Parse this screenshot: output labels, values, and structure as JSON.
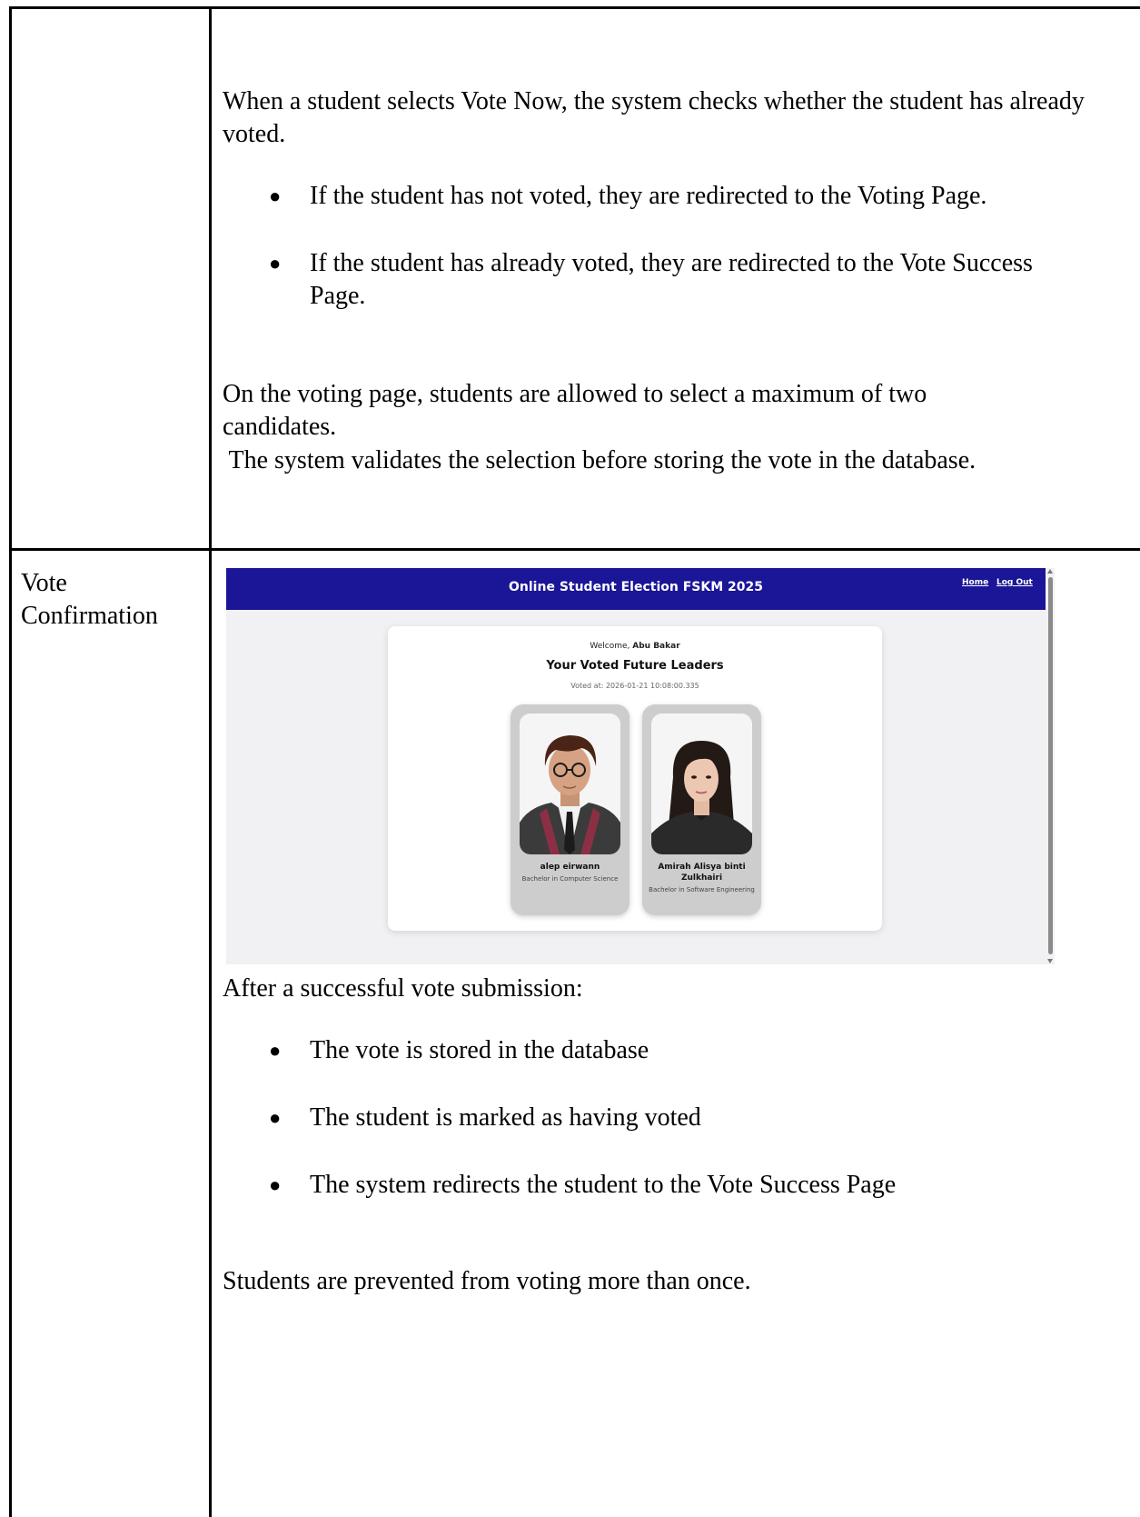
{
  "row1": {
    "intro": "When a student selects Vote Now, the system checks whether the student has already voted.",
    "bullets": [
      "If the student has not voted, they are redirected to the Voting Page.",
      "If the student has already voted, they are redirected to the Vote Success Page."
    ],
    "voting_page_line1": "On the voting page, students are allowed to select a maximum of two candidates.",
    "voting_page_line2": " The system validates the selection before storing the vote in the database."
  },
  "row2": {
    "label": "Vote Confirmation",
    "screenshot": {
      "header_title": "Online Student Election FSKM 2025",
      "nav": {
        "home": "Home",
        "logout": "Log Out"
      },
      "welcome_prefix": "Welcome,",
      "welcome_name": "Abu Bakar",
      "title": "Your Voted Future Leaders",
      "voted_at": "Voted at: 2026-01-21 10:08:00.335",
      "candidates": [
        {
          "name": "alep eirwann",
          "program": "Bachelor in Computer Science"
        },
        {
          "name": "Amirah Alisya binti Zulkhairi",
          "program": "Bachelor in Software Engineering"
        }
      ],
      "colors": {
        "header": "#1a1697",
        "card_bg": "#ffffff",
        "candidate_bg": "#cdcdcd",
        "page_bg": "#f1f1f3"
      }
    },
    "after_intro": "After a successful vote submission:",
    "after_bullets": [
      "The vote is stored in the database",
      "The student is marked as having voted",
      "The system redirects the student to the Vote Success Page"
    ],
    "closing": "Students are prevented from voting more than once."
  }
}
